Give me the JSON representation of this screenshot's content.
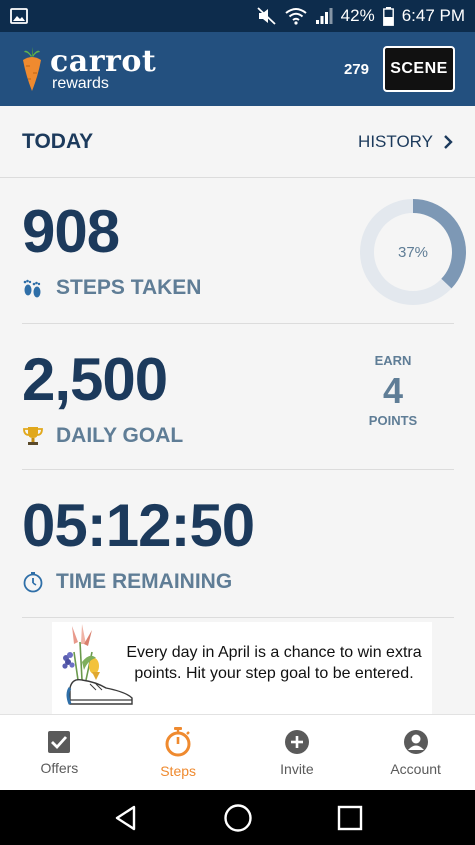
{
  "status_bar": {
    "battery": "42%",
    "time": "6:47 PM"
  },
  "header": {
    "logo_main": "carrot",
    "logo_sub": "rewards",
    "points": "279",
    "partner_badge": "SCENE"
  },
  "today": {
    "title": "TODAY",
    "history_label": "HISTORY"
  },
  "steps": {
    "value": "908",
    "label": "STEPS TAKEN",
    "progress_text": "37%",
    "progress_fraction": 0.37
  },
  "goal": {
    "value": "2,500",
    "label": "DAILY GOAL",
    "earn_label": "EARN",
    "earn_value": "4",
    "points_label": "POINTS"
  },
  "timer": {
    "value": "05:12:50",
    "label": "TIME REMAINING"
  },
  "promo": {
    "text": "Every day in April is a chance to win extra points. Hit your step goal to be entered."
  },
  "tabs": [
    {
      "label": "Offers",
      "icon": "checkbox-icon"
    },
    {
      "label": "Steps",
      "icon": "stopwatch-icon",
      "active": true
    },
    {
      "label": "Invite",
      "icon": "plus-circle-icon"
    },
    {
      "label": "Account",
      "icon": "person-icon"
    }
  ],
  "colors": {
    "header": "#23507f",
    "status_bar": "#0d2c4c",
    "primary_text": "#1c3a5c",
    "muted_text": "#5f7d96",
    "accent": "#ef8a2f",
    "progress": "#7d98b5",
    "progress_track": "#e3e8ee"
  }
}
